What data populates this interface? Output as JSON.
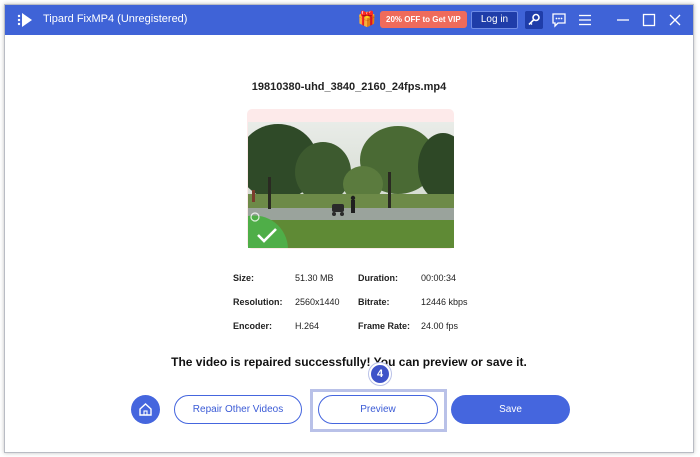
{
  "app": {
    "title": "Tipard FixMP4 (Unregistered)",
    "promo_label": "20% OFF to Get VIP",
    "login_label": "Log in",
    "icons": [
      "app-logo-icon",
      "gift-icon",
      "key-icon",
      "feedback-icon",
      "menu-icon",
      "minimize-icon",
      "maximize-icon",
      "close-icon"
    ]
  },
  "file": {
    "name": "19810380-uhd_3840_2160_24fps.mp4"
  },
  "info": {
    "size_label": "Size:",
    "size_value": "51.30 MB",
    "duration_label": "Duration:",
    "duration_value": "00:00:34",
    "resolution_label": "Resolution:",
    "resolution_value": "2560x1440",
    "bitrate_label": "Bitrate:",
    "bitrate_value": "12446 kbps",
    "encoder_label": "Encoder:",
    "encoder_value": "H.264",
    "framerate_label": "Frame Rate:",
    "framerate_value": "24.00 fps"
  },
  "message": "The video is repaired successfully! You can preview or save it.",
  "actions": {
    "repair_label": "Repair Other Videos",
    "preview_label": "Preview",
    "save_label": "Save"
  },
  "step_badge": "4",
  "colors": {
    "accent": "#4566de",
    "titlebar": "#3f63d7",
    "promo": "#ef6b5b",
    "success": "#4fae48"
  }
}
